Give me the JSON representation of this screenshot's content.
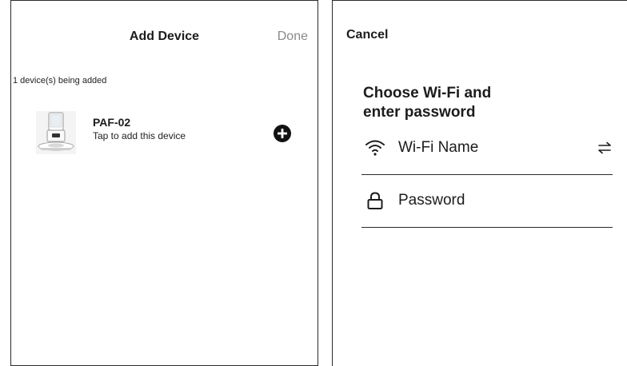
{
  "add_device": {
    "title": "Add Device",
    "done_label": "Done",
    "status_text": "1 device(s) being added",
    "device": {
      "name": "PAF-02",
      "hint": "Tap to add this device",
      "thumbnail_icon": "pet-feeder-icon",
      "action_icon": "plus-circle-icon"
    }
  },
  "wifi_setup": {
    "cancel_label": "Cancel",
    "heading_line1": "Choose Wi-Fi and",
    "heading_line2": "enter password",
    "wifi_field": {
      "icon": "wifi-icon",
      "placeholder": "Wi-Fi Name",
      "switch_icon": "switch-arrows-icon"
    },
    "password_field": {
      "icon": "lock-icon",
      "placeholder": "Password"
    }
  },
  "colors": {
    "text": "#1c1c1c",
    "muted": "#8a8a8a",
    "border": "#2b2b2b",
    "background": "#ffffff"
  }
}
